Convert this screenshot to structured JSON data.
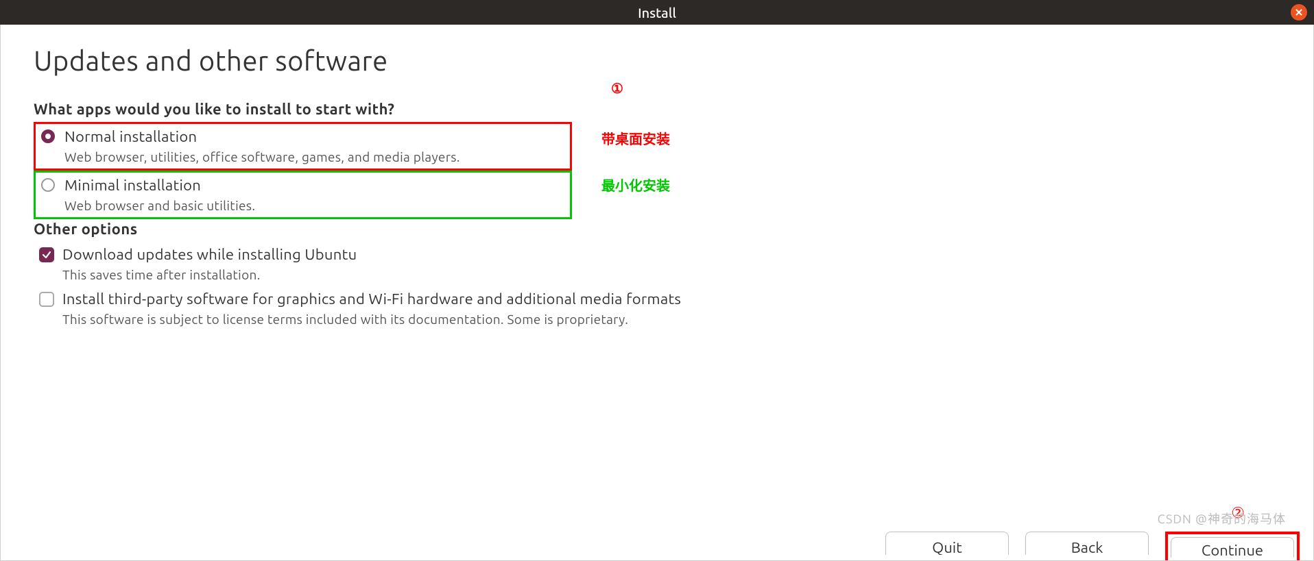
{
  "titlebar": {
    "title": "Install"
  },
  "page": {
    "title": "Updates and other software"
  },
  "apps_section": {
    "heading": "What apps would you like to install to start with?",
    "normal": {
      "label": "Normal installation",
      "desc": "Web browser, utilities, office software, games, and media players."
    },
    "minimal": {
      "label": "Minimal installation",
      "desc": "Web browser and basic utilities."
    }
  },
  "other_section": {
    "heading": "Other options",
    "download": {
      "label": "Download updates while installing Ubuntu",
      "desc": "This saves time after installation."
    },
    "thirdparty": {
      "label": "Install third-party software for graphics and Wi-Fi hardware and additional media formats",
      "desc": "This software is subject to license terms included with its documentation. Some is proprietary."
    }
  },
  "annotations": {
    "circle1": "①",
    "normal_note": "带桌面安装",
    "minimal_note": "最小化安装",
    "circle2": "②"
  },
  "buttons": {
    "quit": "Quit",
    "back": "Back",
    "continue": "Continue"
  },
  "watermark": "CSDN @神奇的海马体"
}
